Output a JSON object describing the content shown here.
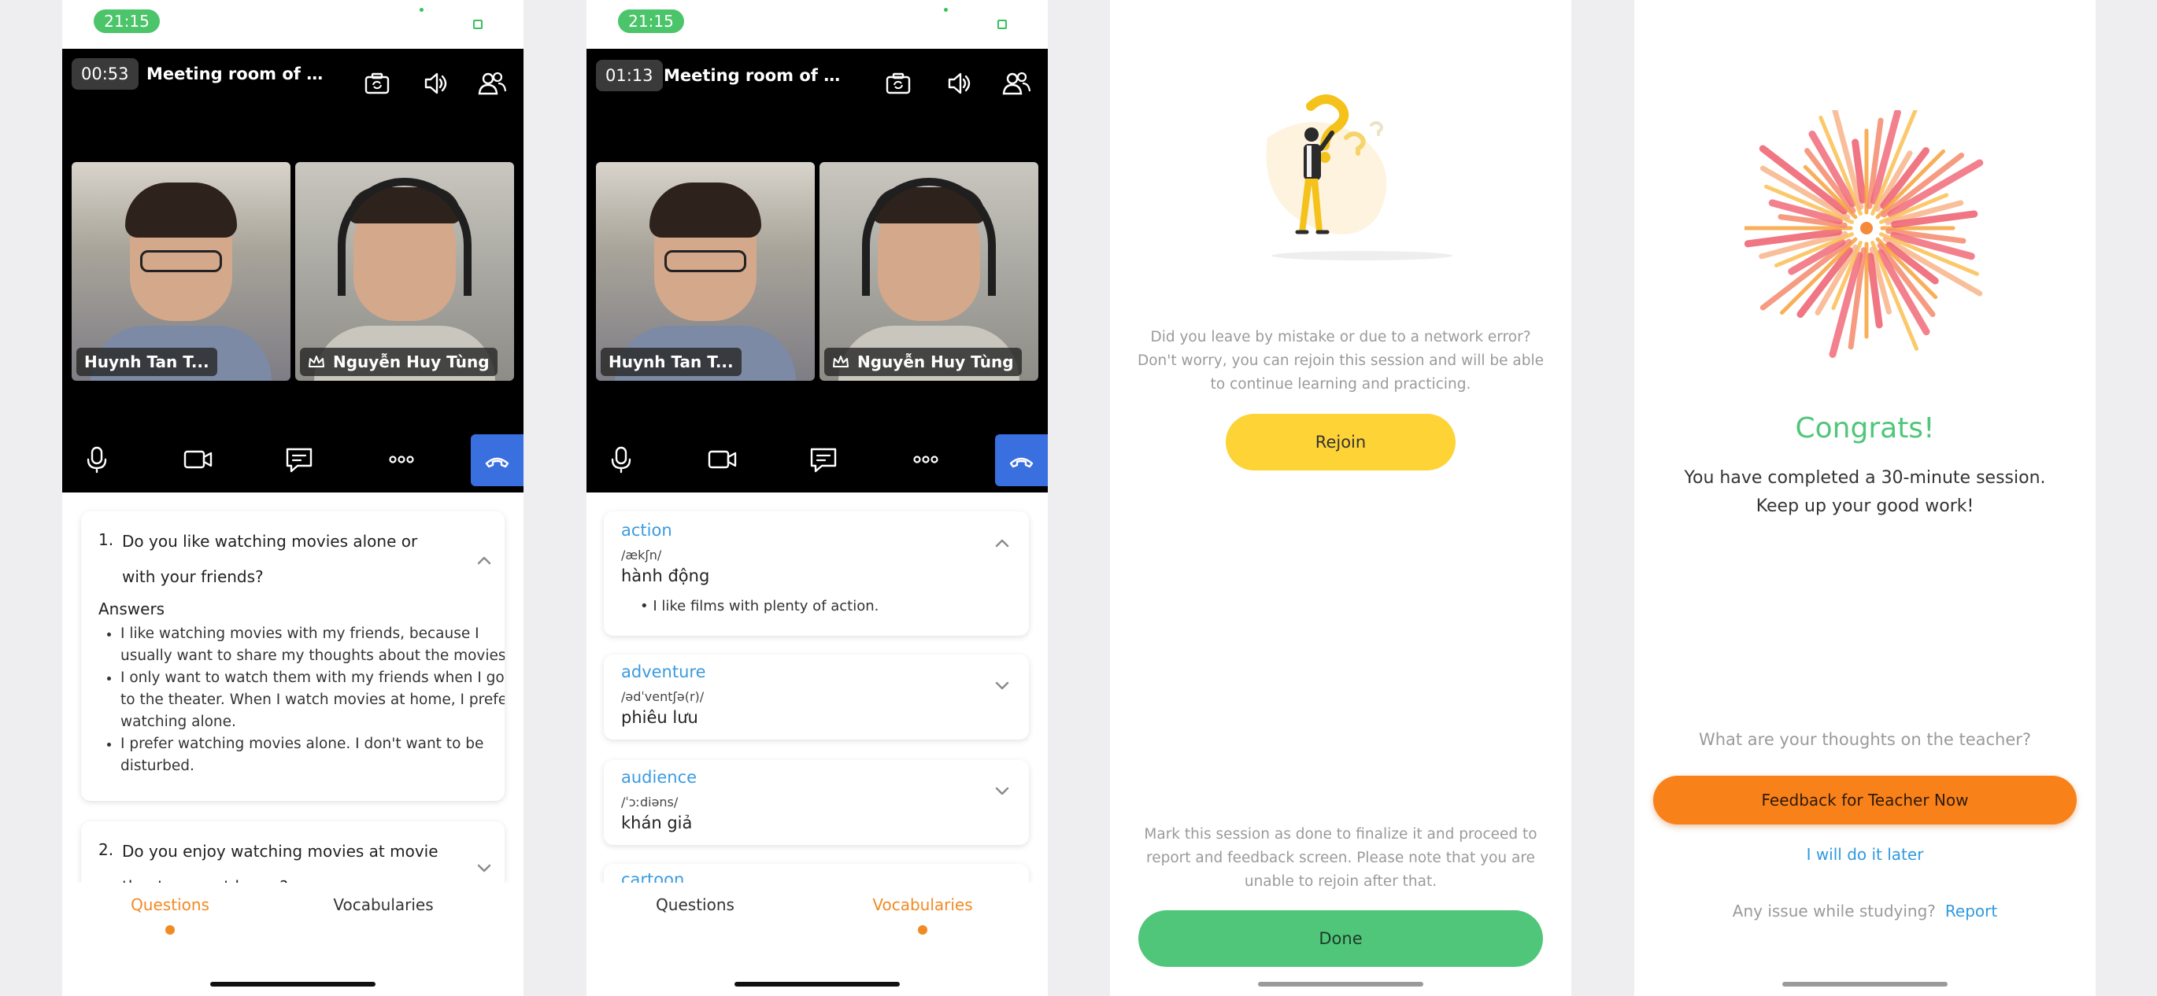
{
  "status_bar": {
    "time": "21:15"
  },
  "screen1": {
    "timer": "00:53",
    "room_title": "Meeting room of Huyn...",
    "participants": [
      {
        "name": "Huynh Tan T...",
        "host": false
      },
      {
        "name": "Nguyễn Huy Tùng",
        "host": true
      }
    ],
    "questions": [
      {
        "number": "1.",
        "text": "Do you like watching movies alone or with your friends?",
        "answers_title": "Answers",
        "answers": [
          "I like watching movies with my friends, because I usually want to share my thoughts about the movies.",
          "I only want to watch them with my friends when I go to the theater. When I watch movies at home, I prefer watching alone.",
          "I prefer watching movies alone. I don't want to be disturbed."
        ]
      },
      {
        "number": "2.",
        "text": "Do you enjoy watching movies at movie theaters or at home?"
      }
    ],
    "tabs": {
      "questions": "Questions",
      "vocabularies": "Vocabularies",
      "active": "questions"
    }
  },
  "screen2": {
    "timer": "01:13",
    "room_title": "Meeting room of Huyn...",
    "participants": [
      {
        "name": "Huynh Tan T...",
        "host": false
      },
      {
        "name": "Nguyễn Huy Tùng",
        "host": true
      }
    ],
    "vocabularies": [
      {
        "word": "action",
        "phonetic": "/ækʃn/",
        "meaning": "hành động",
        "example": "I like films with plenty of action.",
        "expanded": true
      },
      {
        "word": "adventure",
        "phonetic": "/ədˈventʃə(r)/",
        "meaning": "phiêu lưu",
        "expanded": false
      },
      {
        "word": "audience",
        "phonetic": "/ˈɔːdiəns/",
        "meaning": "khán giả",
        "expanded": false
      },
      {
        "word": "cartoon",
        "expanded": false
      }
    ],
    "tabs": {
      "questions": "Questions",
      "vocabularies": "Vocabularies",
      "active": "vocabularies"
    }
  },
  "screen3": {
    "rejoin_message": "Did you leave by mistake or due to a network error? Don't worry, you can rejoin this session and will be able to continue learning and practicing.",
    "rejoin_label": "Rejoin",
    "done_message": "Mark this session as done to finalize it and proceed to report and feedback screen. Please note that you are unable to rejoin after that.",
    "done_label": "Done"
  },
  "screen4": {
    "congrats": "Congrats!",
    "completed_line1": "You have completed a 30-minute session.",
    "completed_line2": "Keep up your good work!",
    "thoughts": "What are your thoughts on the teacher?",
    "feedback_label": "Feedback for Teacher Now",
    "later_label": "I will do it later",
    "issue_text": "Any issue while studying?",
    "report_label": "Report"
  },
  "colors": {
    "status_green": "#4cc46a",
    "end_call_blue": "#3a6fe0",
    "tab_active_orange": "#f28a24",
    "vocab_word_blue": "#3a9be0",
    "rejoin_yellow": "#fdd336",
    "done_green": "#4fc679",
    "feedback_orange": "#f9811a",
    "link_blue": "#2f9ae0"
  },
  "icons": [
    "camera-switch-icon",
    "speaker-icon",
    "participants-icon",
    "microphone-icon",
    "video-icon",
    "chat-icon",
    "more-icon",
    "end-call-icon",
    "crown-icon",
    "chevron-up-icon",
    "chevron-down-icon"
  ]
}
